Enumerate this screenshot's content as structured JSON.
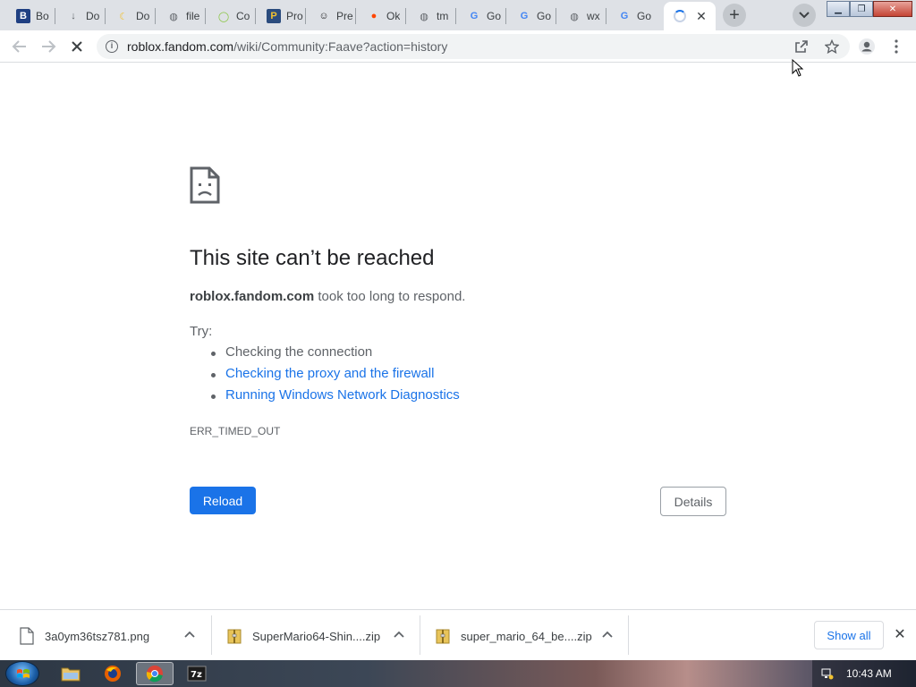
{
  "tabs": [
    {
      "title": "Bo",
      "icon": "b-icon",
      "color": "#1f3f82",
      "glyph": "B"
    },
    {
      "title": "Do",
      "icon": "download-icon",
      "color": "#5f6368",
      "glyph": "↓"
    },
    {
      "title": "Do",
      "icon": "banana-icon",
      "color": "#f2c230",
      "glyph": "☾"
    },
    {
      "title": "file",
      "icon": "globe-icon",
      "color": "#5f6368",
      "glyph": "◍"
    },
    {
      "title": "Co",
      "icon": "circle-icon",
      "color": "#88c540",
      "glyph": "◯"
    },
    {
      "title": "Pro",
      "icon": "p-icon",
      "color": "#2b4c7e",
      "glyph": "P"
    },
    {
      "title": "Pre",
      "icon": "smiley-icon",
      "color": "#202124",
      "glyph": "☺"
    },
    {
      "title": "Ok",
      "icon": "reddit-icon",
      "color": "#ff4500",
      "glyph": "●"
    },
    {
      "title": "tm",
      "icon": "globe-icon",
      "color": "#5f6368",
      "glyph": "◍"
    },
    {
      "title": "Go",
      "icon": "google-icon",
      "color": "#4285f4",
      "glyph": "G"
    },
    {
      "title": "Go",
      "icon": "google-icon",
      "color": "#4285f4",
      "glyph": "G"
    },
    {
      "title": "wx",
      "icon": "globe-icon",
      "color": "#5f6368",
      "glyph": "◍"
    },
    {
      "title": "Go",
      "icon": "google-icon",
      "color": "#4285f4",
      "glyph": "G"
    }
  ],
  "url": {
    "host": "roblox.fandom.com",
    "path": "/wiki/Community:Faave?action=history"
  },
  "error": {
    "title": "This site can’t be reached",
    "host": "roblox.fandom.com",
    "desc_rest": " took too long to respond.",
    "try_label": "Try:",
    "suggestions": [
      {
        "text": "Checking the connection",
        "link": false
      },
      {
        "text": "Checking the proxy and the firewall",
        "link": true
      },
      {
        "text": "Running Windows Network Diagnostics",
        "link": true
      }
    ],
    "code": "ERR_TIMED_OUT",
    "reload_label": "Reload",
    "details_label": "Details"
  },
  "downloads": {
    "items": [
      {
        "name": "3a0ym36tsz781.png",
        "icon": "file-icon"
      },
      {
        "name": "SuperMario64-Shin....zip",
        "icon": "zip-folder-icon"
      },
      {
        "name": "super_mario_64_be....zip",
        "icon": "zip-folder-icon"
      }
    ],
    "show_all_label": "Show all"
  },
  "taskbar": {
    "clock": "10:43 AM"
  }
}
